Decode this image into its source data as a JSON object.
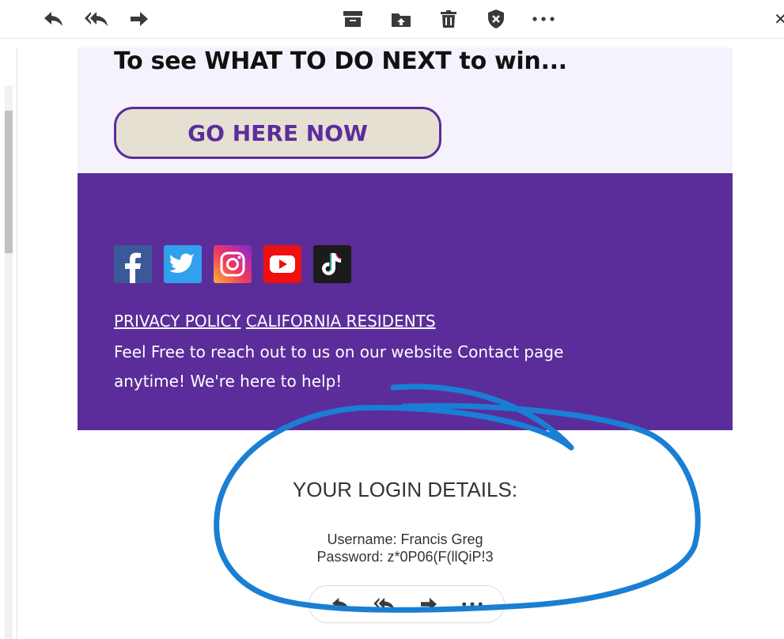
{
  "toolbar": {
    "left_icons": [
      "reply-icon",
      "reply-all-icon",
      "forward-icon"
    ],
    "center_icons": [
      "archive-icon",
      "move-to-icon",
      "delete-icon",
      "block-sender-icon",
      "more-icon"
    ]
  },
  "email": {
    "hero_heading": "To see WHAT TO DO NEXT to win...",
    "cta_label": "GO HERE NOW",
    "social_icons": [
      "facebook-icon",
      "twitter-icon",
      "instagram-icon",
      "youtube-icon",
      "tiktok-icon"
    ],
    "privacy_link": "PRIVACY POLICY",
    "california_link": "CALIFORNIA RESIDENTS",
    "footer_line_1": "Feel Free to reach out to us on our website Contact page",
    "footer_line_2": "anytime! We're here to help!",
    "login_heading": "YOUR LOGIN DETAILS:",
    "username_line": "Username: Francis Greg",
    "password_line": "Password: z*0P06(F(llQiP!3"
  },
  "floating_actions": [
    "reply-icon",
    "reply-all-icon",
    "forward-icon",
    "more-icon"
  ],
  "colors": {
    "footer_purple": "#5b2d9a",
    "hero_background": "#f6f2fd",
    "cta_border": "#5c2d9c",
    "cta_fill": "#e6e0d3",
    "annotation_blue": "#1a7fd4"
  }
}
